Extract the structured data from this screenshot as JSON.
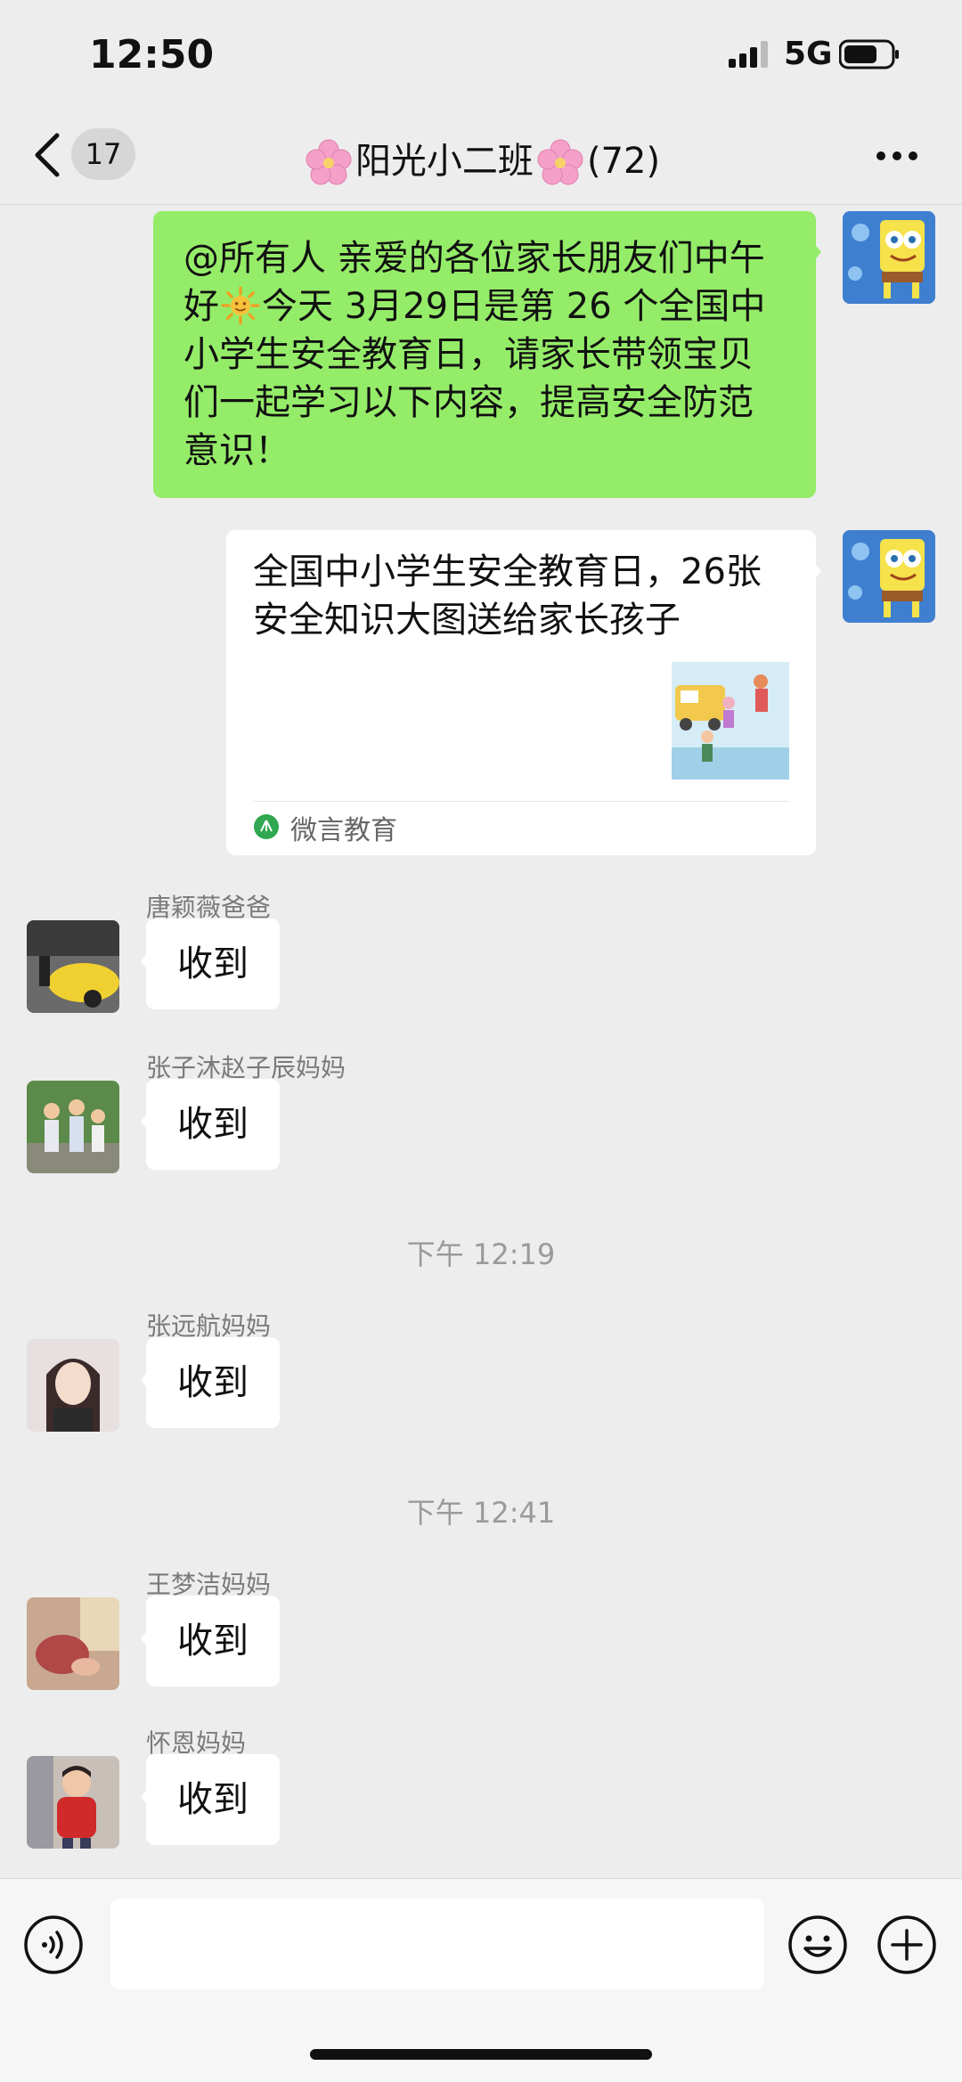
{
  "status_bar": {
    "time": "12:50",
    "network": "5G"
  },
  "nav": {
    "back_badge": "17",
    "title": "阳光小二班",
    "member_count": "(72)"
  },
  "messages": {
    "m1": {
      "text_part1": "@所有人 亲爱的各位家长朋友们中午好",
      "text_part2": "今天 3月29日是第 26 个全国中小学生安全教育日，请家长带领宝贝们一起学习以下内容，提高安全防范意识！"
    },
    "m2": {
      "title": "全国中小学生安全教育日，26张安全知识大图送给家长孩子",
      "source": "微言教育"
    },
    "m3": {
      "sender": "唐颖薇爸爸",
      "text": "收到"
    },
    "m4": {
      "sender": "张子沐赵子辰妈妈",
      "text": "收到"
    },
    "t1": "下午 12:19",
    "m5": {
      "sender": "张远航妈妈",
      "text": "收到"
    },
    "t2": "下午 12:41",
    "m6": {
      "sender": "王梦洁妈妈",
      "text": "收到"
    },
    "m7": {
      "sender": "怀恩妈妈",
      "text": "收到"
    }
  },
  "input": {
    "value": ""
  },
  "colors": {
    "sent_bubble": "#95ec69",
    "background": "#ededed"
  }
}
